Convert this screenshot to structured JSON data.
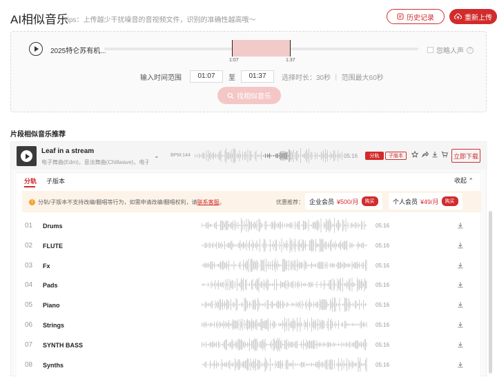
{
  "header": {
    "title": "AI相似音乐",
    "tips": "Tips：上传越少干扰噪音的音视频文件，识别的准确性越高哦～",
    "history_label": "历史记录",
    "reupload_label": "重新上传"
  },
  "player": {
    "track_name": "2025特仑苏有机...",
    "range_start_tick": "1:07",
    "range_end_tick": "1:37",
    "ignore_vocal_label": "忽略人声",
    "help_glyph": "?"
  },
  "range": {
    "label": "输入时间范围",
    "start": "01:07",
    "sep": "至",
    "end": "01:37",
    "hint": "选择时长：30秒 ｜ 范围最大60秒"
  },
  "find_button_label": "找相似音乐",
  "section_title": "片段相似音乐推荐",
  "song": {
    "name": "Leaf in a stream",
    "tags": "电子舞曲(Edm)，意淡舞曲(Chillwave)，电子...",
    "bpm": "BPM:144",
    "duration": "05:16",
    "tag_fen": "分轨",
    "tag_zi": "子版本",
    "download_now": "立即下载"
  },
  "tabs": [
    {
      "label": "分轨"
    },
    {
      "label": "子版本"
    }
  ],
  "collapse_label": "收起",
  "notice": {
    "text": "分轨/子版本不支持改编/翻唱等行为，如需申请改编/翻唱权利，请",
    "link": "联系客服",
    "end": "。",
    "promo_label": "优惠推荐："
  },
  "members": [
    {
      "name": "企业会员",
      "price": "¥500/月",
      "buy": "购买"
    },
    {
      "name": "个人会员",
      "price": "¥49/月",
      "buy": "购买"
    }
  ],
  "stems": [
    {
      "num": "01",
      "name": "Drums",
      "duration": "05:16"
    },
    {
      "num": "02",
      "name": "FLUTE",
      "duration": "05:16"
    },
    {
      "num": "03",
      "name": "Fx",
      "duration": "05:16"
    },
    {
      "num": "04",
      "name": "Pads",
      "duration": "05:16"
    },
    {
      "num": "05",
      "name": "Piano",
      "duration": "05:16"
    },
    {
      "num": "06",
      "name": "Strings",
      "duration": "05:16"
    },
    {
      "num": "07",
      "name": "SYNTH BASS",
      "duration": "05:16"
    },
    {
      "num": "08",
      "name": "Synths",
      "duration": "05:16"
    }
  ],
  "colors": {
    "accent": "#d22b2b",
    "range_fill": "#f3caca",
    "wave": "#cccccc",
    "wave_played": "#888888",
    "notice_bg": "#fdf3e8"
  },
  "icons": {
    "history": "history-icon",
    "upload": "cloud-upload-icon",
    "play": "play-icon",
    "search": "search-icon",
    "star": "star-icon",
    "share": "share-icon",
    "download": "download-icon",
    "cart": "cart-icon"
  }
}
